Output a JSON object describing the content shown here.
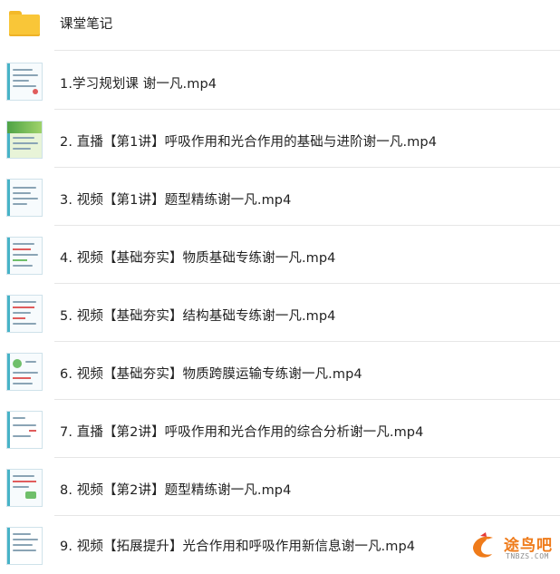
{
  "items": [
    {
      "type": "folder",
      "name": "课堂笔记"
    },
    {
      "type": "video",
      "name": "1.学习规划课 谢一凡.mp4",
      "thumb": "doc"
    },
    {
      "type": "video",
      "name": "2. 直播【第1讲】呼吸作用和光合作用的基础与进阶谢一凡.mp4",
      "thumb": "green"
    },
    {
      "type": "video",
      "name": "3. 视频【第1讲】题型精练谢一凡.mp4",
      "thumb": "doc"
    },
    {
      "type": "video",
      "name": "4. 视频【基础夯实】物质基础专练谢一凡.mp4",
      "thumb": "doc"
    },
    {
      "type": "video",
      "name": "5. 视频【基础夯实】结构基础专练谢一凡.mp4",
      "thumb": "doc"
    },
    {
      "type": "video",
      "name": "6. 视频【基础夯实】物质跨膜运输专练谢一凡.mp4",
      "thumb": "doc"
    },
    {
      "type": "video",
      "name": "7. 直播【第2讲】呼吸作用和光合作用的综合分析谢一凡.mp4",
      "thumb": "doc"
    },
    {
      "type": "video",
      "name": "8. 视频【第2讲】题型精练谢一凡.mp4",
      "thumb": "doc"
    },
    {
      "type": "video",
      "name": "9. 视频【拓展提升】光合作用和呼吸作用新信息谢一凡.mp4",
      "thumb": "doc"
    }
  ],
  "watermark": {
    "text": "途鸟吧",
    "sub": "TNBZS.COM",
    "icon": "bird-logo-icon"
  },
  "colors": {
    "folder": "#f9c638",
    "separator": "#e6e6e6",
    "watermark": "#ef7b1a"
  }
}
